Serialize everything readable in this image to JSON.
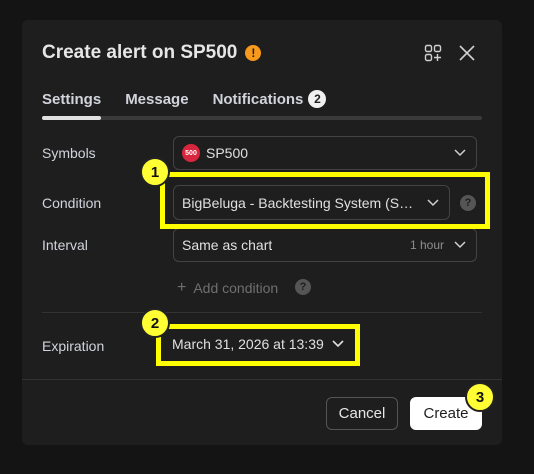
{
  "dialog": {
    "title": "Create alert on SP500",
    "warning_icon": "!"
  },
  "tabs": [
    {
      "label": "Settings",
      "active": true
    },
    {
      "label": "Message"
    },
    {
      "label": "Notifications",
      "badge": "2"
    }
  ],
  "fields": {
    "symbols": {
      "label": "Symbols",
      "logo_text": "500",
      "value": "SP500"
    },
    "condition": {
      "label": "Condition",
      "value": "BigBeluga - Backtesting System (SMC..."
    },
    "interval": {
      "label": "Interval",
      "value": "Same as chart",
      "hint": "1 hour"
    },
    "add_condition": "Add condition",
    "expiration": {
      "label": "Expiration",
      "value": "March 31, 2026 at 13:39"
    }
  },
  "buttons": {
    "cancel": "Cancel",
    "create": "Create"
  },
  "annotations": [
    "1",
    "2",
    "3"
  ],
  "colors": {
    "highlight": "#ffff00",
    "create_bg": "#ffffff",
    "warning": "#f79a1c",
    "symbol_logo": "#d7263d"
  }
}
